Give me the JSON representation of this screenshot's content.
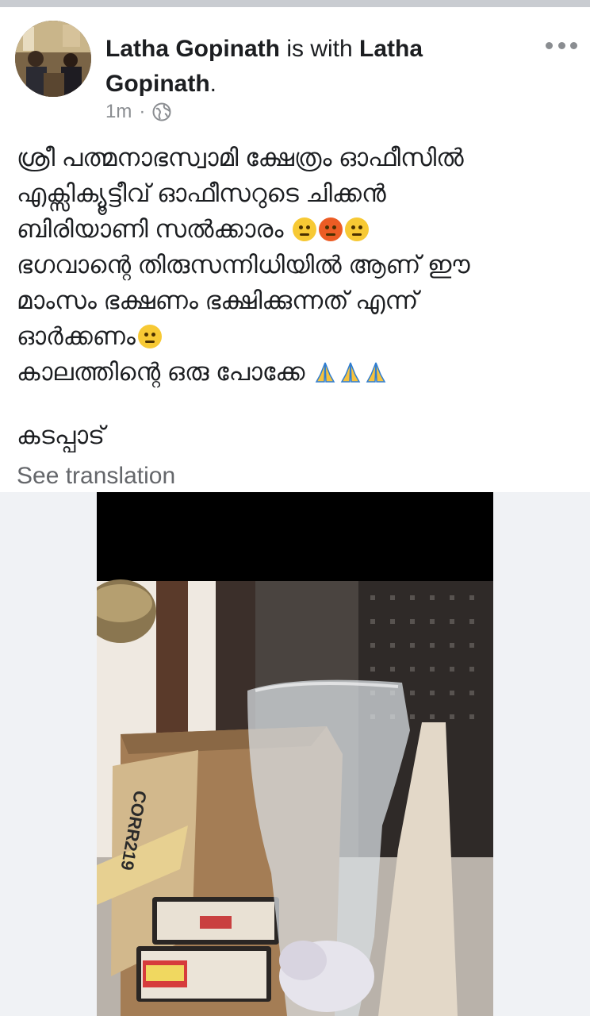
{
  "post": {
    "author": "Latha Gopinath",
    "with_text": "is with",
    "tagged": "Latha Gopinath",
    "period": ".",
    "time": "1m",
    "dot": "·",
    "lines": [
      "ശ്രീ പത്മനാഭസ്വാമി ക്ഷേത്രം ഓഫീസിൽ",
      "എക്സിക്യൂട്ടീവ് ഓഫീസറുടെ ചിക്കൻ",
      "ബിരിയാണി സൽക്കാരം",
      "ഭഗവാന്റെ തിരുസന്നിധിയിൽ ആണ് ഈ",
      "മാംസം ഭക്ഷണം ഭക്ഷിക്കുന്നത് എന്ന്",
      "ഓർക്കണം",
      "കാലത്തിന്റെ ഒരു പോക്കേ"
    ],
    "signoff": "കടപ്പാട്",
    "see_translation": "See translation"
  },
  "photo": {
    "box_label": "CORR219"
  },
  "icons": {
    "globe": "globe-icon",
    "more": "more-icon",
    "thinking": "thinking-face-emoji",
    "angry": "angry-face-emoji",
    "annoyed": "annoyed-face-emoji",
    "relieved": "relieved-face-emoji",
    "pray": "folded-hands-emoji"
  },
  "colors": {
    "primary_text": "#1c1e21",
    "secondary_text": "#65676b",
    "meta_text": "#8a8d91"
  }
}
